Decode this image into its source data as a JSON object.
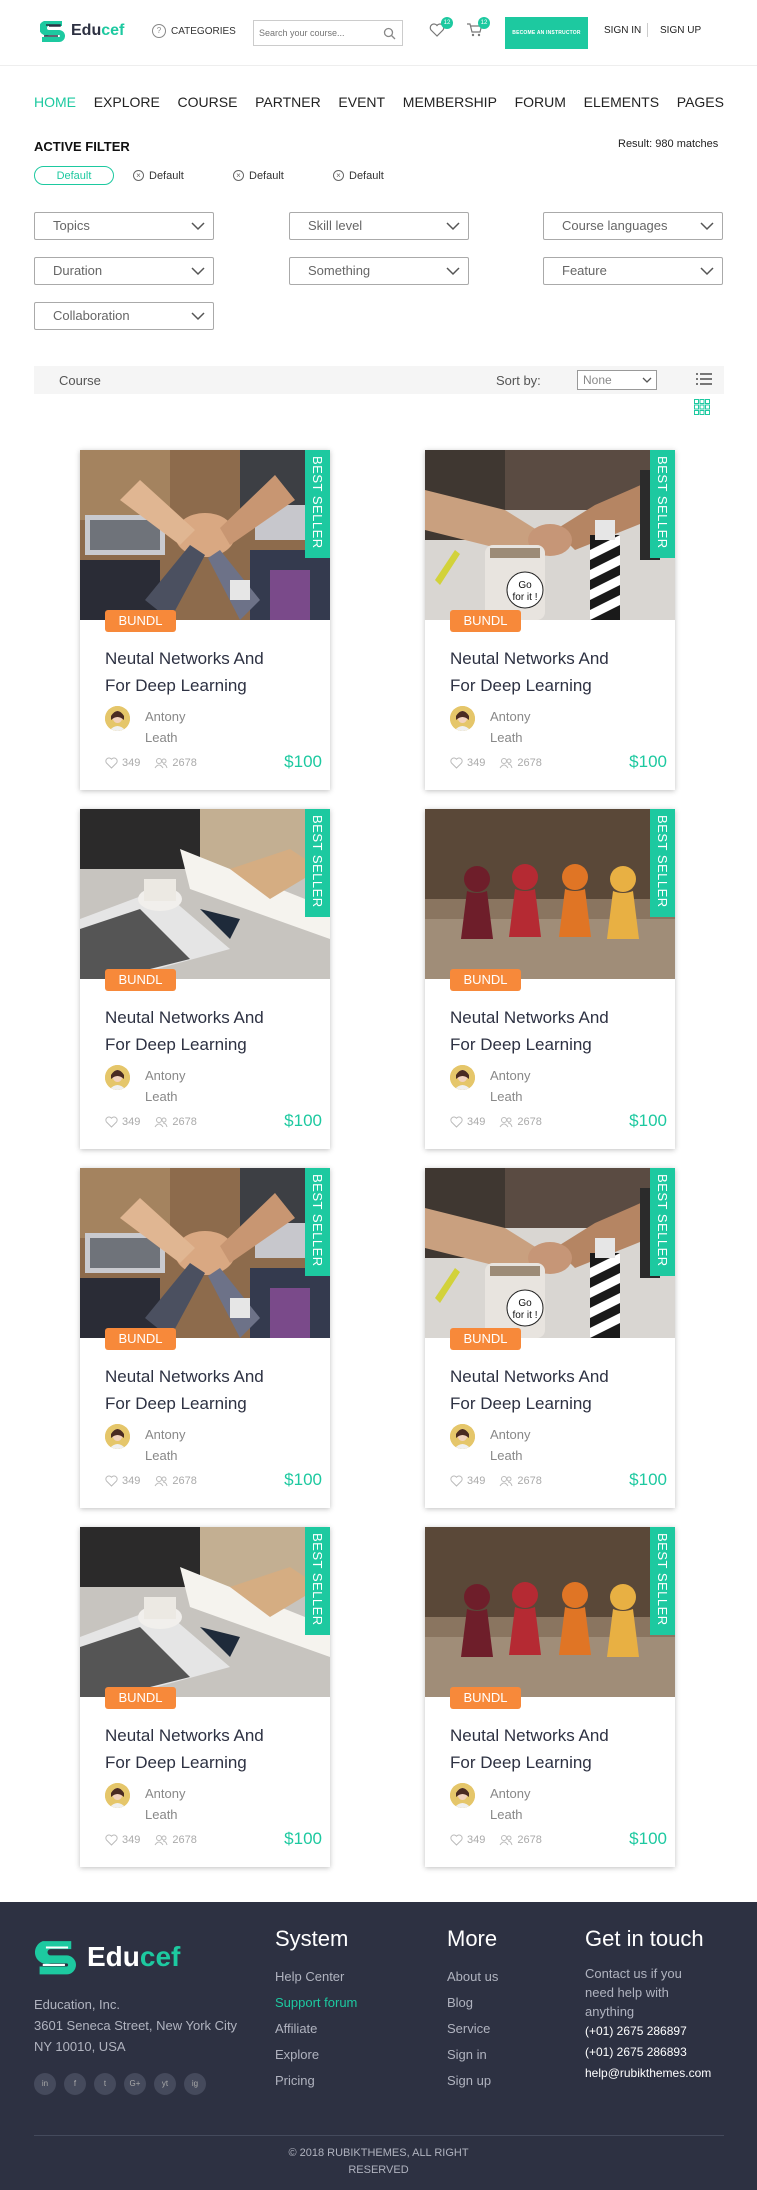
{
  "header": {
    "logo_text_a": "Edu",
    "logo_text_b": "cef",
    "categories_label": "CATEGORIES",
    "search_placeholder": "Search your course...",
    "wishlist_count": "12",
    "cart_count": "12",
    "become_instructor": "BECOME AN INSTRUCTOR",
    "sign_in": "SIGN IN",
    "sign_up": "SIGN UP"
  },
  "nav": [
    "HOME",
    "EXPLORE",
    "COURSE",
    "PARTNER",
    "EVENT",
    "MEMBERSHIP",
    "FORUM",
    "ELEMENTS",
    "PAGES"
  ],
  "filter": {
    "title": "ACTIVE FILTER",
    "result": "Result: 980 matches",
    "chips": [
      "Default",
      "Default",
      "Default",
      "Default"
    ],
    "dropdowns": [
      "Topics",
      "Skill level",
      "Course languages",
      "Duration",
      "Something",
      "Feature",
      "Collaboration"
    ]
  },
  "toolbar": {
    "course_label": "Course",
    "sort_label": "Sort by:",
    "sort_value": "None"
  },
  "card": {
    "ribbon": "BEST SELLER",
    "bundl": "BUNDL",
    "title_line1": "Neutal Networks And",
    "title_line2": "For Deep Learning",
    "author_first": "Antony",
    "author_last": "Leath",
    "likes": "349",
    "students": "2678",
    "price": "$100"
  },
  "colors": {
    "accent": "#1dc9a0",
    "orange": "#f7893a",
    "footer": "#2d3142"
  },
  "footer": {
    "logo_a": "Edu",
    "logo_b": "cef",
    "address": [
      "Education, Inc.",
      "3601 Seneca Street, New York City",
      "NY 10010, USA"
    ],
    "socials": [
      "in",
      "f",
      "t",
      "G+",
      "yt",
      "ig"
    ],
    "system": {
      "title": "System",
      "items": [
        "Help Center",
        "Support forum",
        "Affiliate",
        "Explore",
        "Pricing"
      ]
    },
    "more": {
      "title": "More",
      "items": [
        "About us",
        "Blog",
        "Service",
        "Sign in",
        "Sign up"
      ]
    },
    "touch": {
      "title": "Get in touch",
      "text": "Contact us if you need help with anything",
      "phone1": "(+01) 2675 286897",
      "phone2": "(+01) 2675 286893",
      "email": "help@rubikthemes.com"
    },
    "copyright1": "© 2018 RUBIKTHEMES, ALL RIGHT",
    "copyright2": "RESERVED"
  }
}
